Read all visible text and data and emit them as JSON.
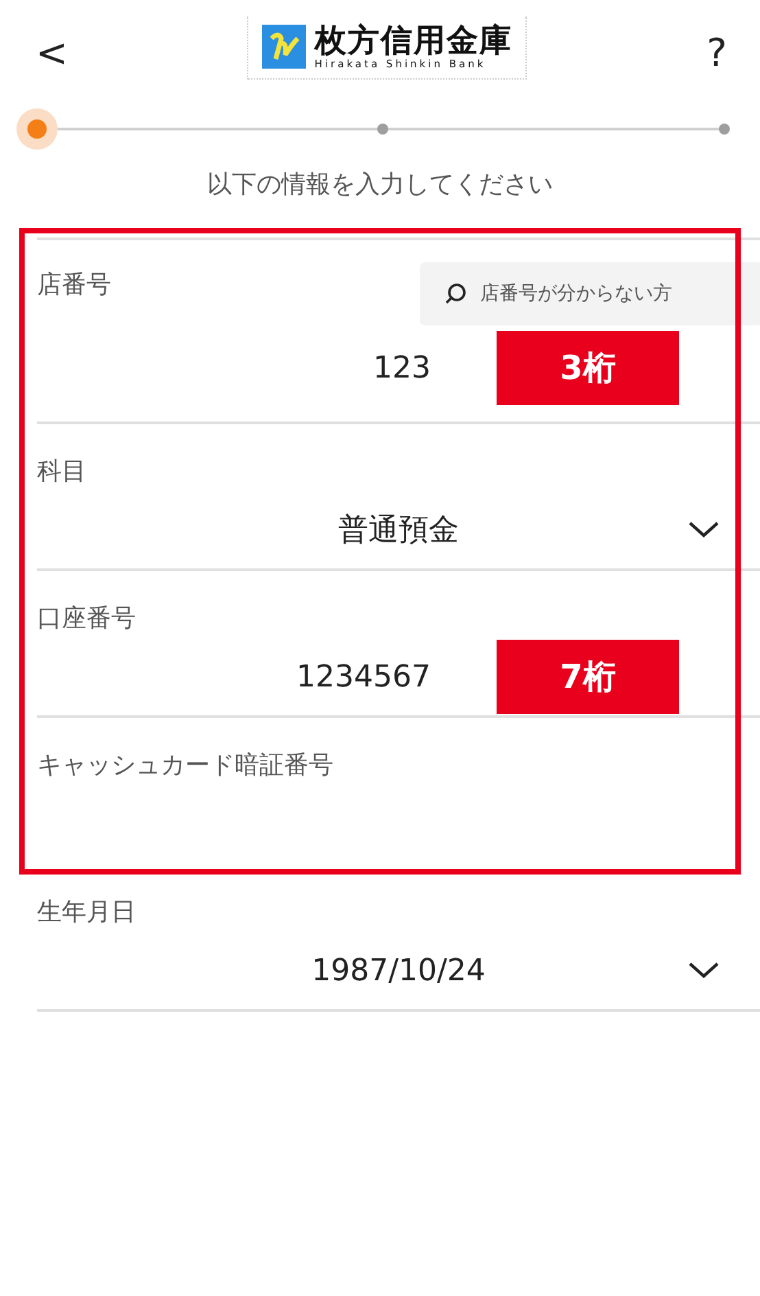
{
  "header": {
    "back": "<",
    "logo_title": "枚方信用金庫",
    "logo_subtitle": "Hirakata Shinkin Bank",
    "help": "?"
  },
  "progress": [
    {
      "selected": true
    },
    {
      "selected": false
    },
    {
      "selected": false
    }
  ],
  "instruction": "以下の情報を入力してください",
  "highlighted_fields": [
    {
      "kind": "text",
      "label": "店番号",
      "value": "123",
      "badge": "3桁",
      "lookup_button": "店番号が分からない方"
    },
    {
      "kind": "select",
      "label": "科目",
      "value": "普通預金"
    },
    {
      "kind": "text",
      "label": "口座番号",
      "value": "1234567",
      "badge": "7桁"
    },
    {
      "kind": "text",
      "label": "キャッシュカード暗証番号"
    }
  ],
  "fields": [
    {
      "kind": "select",
      "label": "生年月日",
      "value": "1987/10/24"
    }
  ]
}
